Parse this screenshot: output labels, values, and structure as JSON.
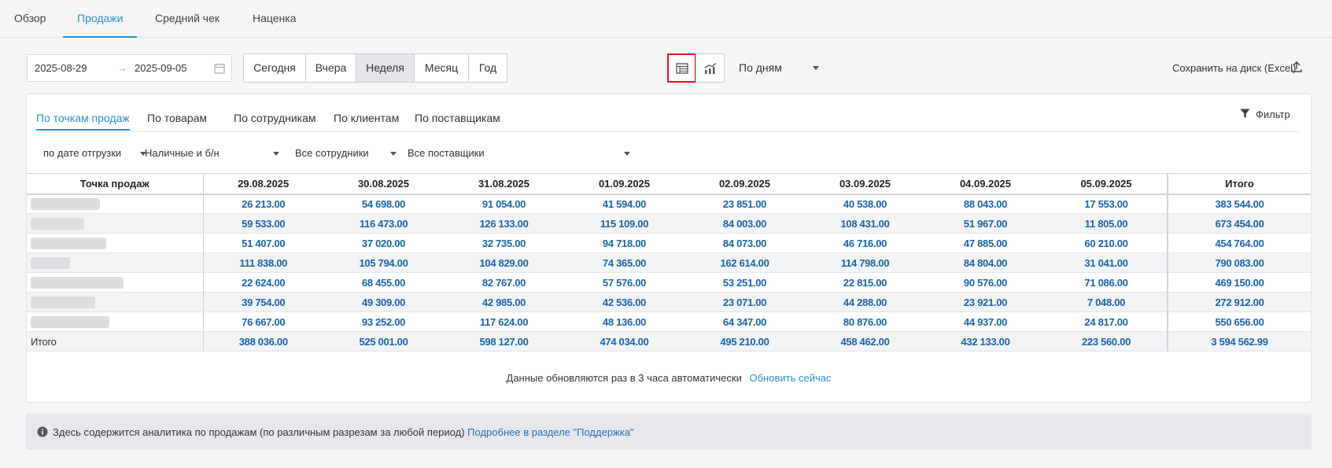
{
  "top_tabs": [
    "Обзор",
    "Продажи",
    "Средний чек",
    "Наценка"
  ],
  "date_from": "2025-08-29",
  "date_to": "2025-09-05",
  "date_arrow": "→",
  "periods": [
    "Сегодня",
    "Вчера",
    "Неделя",
    "Месяц",
    "Год"
  ],
  "active_period": "Неделя",
  "grouping": "По дням",
  "export_label": "Сохранить на диск (Excel)",
  "sub_tabs": [
    "По точкам продаж",
    "По товарам",
    "По сотрудникам",
    "По клиентам",
    "По поставщикам"
  ],
  "filter_label": "Фильтр",
  "filters": {
    "date_type": "по дате отгрузки",
    "payment": "Наличные и б/н",
    "employees": "Все сотрудники",
    "suppliers": "Все поставщики"
  },
  "table": {
    "headers": [
      "Точка продаж",
      "29.08.2025",
      "30.08.2025",
      "31.08.2025",
      "01.09.2025",
      "02.09.2025",
      "03.09.2025",
      "04.09.2025",
      "05.09.2025",
      "Итого"
    ],
    "rows": [
      [
        "26 213.00",
        "54 698.00",
        "91 054.00",
        "41 594.00",
        "23 851.00",
        "40 538.00",
        "88 043.00",
        "17 553.00",
        "383 544.00"
      ],
      [
        "59 533.00",
        "116 473.00",
        "126 133.00",
        "115 109.00",
        "84 003.00",
        "108 431.00",
        "51 967.00",
        "11 805.00",
        "673 454.00"
      ],
      [
        "51 407.00",
        "37 020.00",
        "32 735.00",
        "94 718.00",
        "84 073.00",
        "46 716.00",
        "47 885.00",
        "60 210.00",
        "454 764.00"
      ],
      [
        "111 838.00",
        "105 794.00",
        "104 829.00",
        "74 365.00",
        "162 614.00",
        "114 798.00",
        "84 804.00",
        "31 041.00",
        "790 083.00"
      ],
      [
        "22 624.00",
        "68 455.00",
        "82 767.00",
        "57 576.00",
        "53 251.00",
        "22 815.00",
        "90 576.00",
        "71 086.00",
        "469 150.00"
      ],
      [
        "39 754.00",
        "49 309.00",
        "42 985.00",
        "42 536.00",
        "23 071.00",
        "44 288.00",
        "23 921.00",
        "7 048.00",
        "272 912.00"
      ],
      [
        "76 667.00",
        "93 252.00",
        "117 624.00",
        "48 136.00",
        "64 347.00",
        "80 876.00",
        "44 937.00",
        "24 817.00",
        "550 656.00"
      ]
    ],
    "total_label": "Итого",
    "totals": [
      "388 036.00",
      "525 001.00",
      "598 127.00",
      "474 034.00",
      "495 210.00",
      "458 462.00",
      "432 133.00",
      "223 560.00",
      "3 594 562.99"
    ]
  },
  "refresh_note": "Данные обновляются раз в 3 часа автоматически",
  "refresh_link": "Обновить сейчас",
  "info_text": "Здесь содержится аналитика по продажам (по различным разрезам за любой период)",
  "info_link": "Подробнее в разделе \"Поддержка\"",
  "icons": [
    "table-view-icon",
    "chart-view-icon",
    "calendar-icon",
    "upload-icon",
    "filter-icon",
    "info-icon"
  ],
  "colors": {
    "accent": "#2a8fc9",
    "value": "#1a63a6",
    "highlight": "#e8141c"
  }
}
